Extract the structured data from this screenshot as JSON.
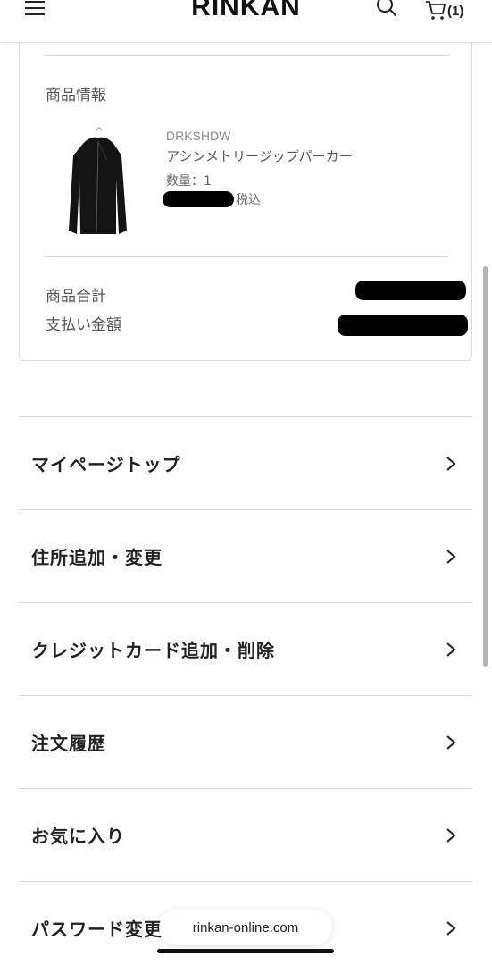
{
  "header": {
    "logo": "RINKAN",
    "menu_icon": "hamburger-menu-icon",
    "search_icon": "search-icon",
    "cart_icon": "cart-icon",
    "cart_count": "(1)"
  },
  "order_card": {
    "section_title": "商品情報",
    "product": {
      "brand": "DRKSHDW",
      "name": "アシンメトリージップパーカー",
      "quantity": "数量：1",
      "price_tax_note": "税込",
      "price_redacted": true
    },
    "summary": {
      "subtotal_label": "商品合計",
      "payment_label": "支払い金額",
      "values_redacted": true
    }
  },
  "menu": {
    "items": [
      {
        "label": "マイページトップ"
      },
      {
        "label": "住所追加・変更"
      },
      {
        "label": "クレジットカード追加・削除"
      },
      {
        "label": "注文履歴"
      },
      {
        "label": "お気に入り"
      },
      {
        "label": "パスワード変更"
      }
    ],
    "chevron_icon": "chevron-right-icon"
  },
  "browser": {
    "url": "rinkan-online.com"
  }
}
